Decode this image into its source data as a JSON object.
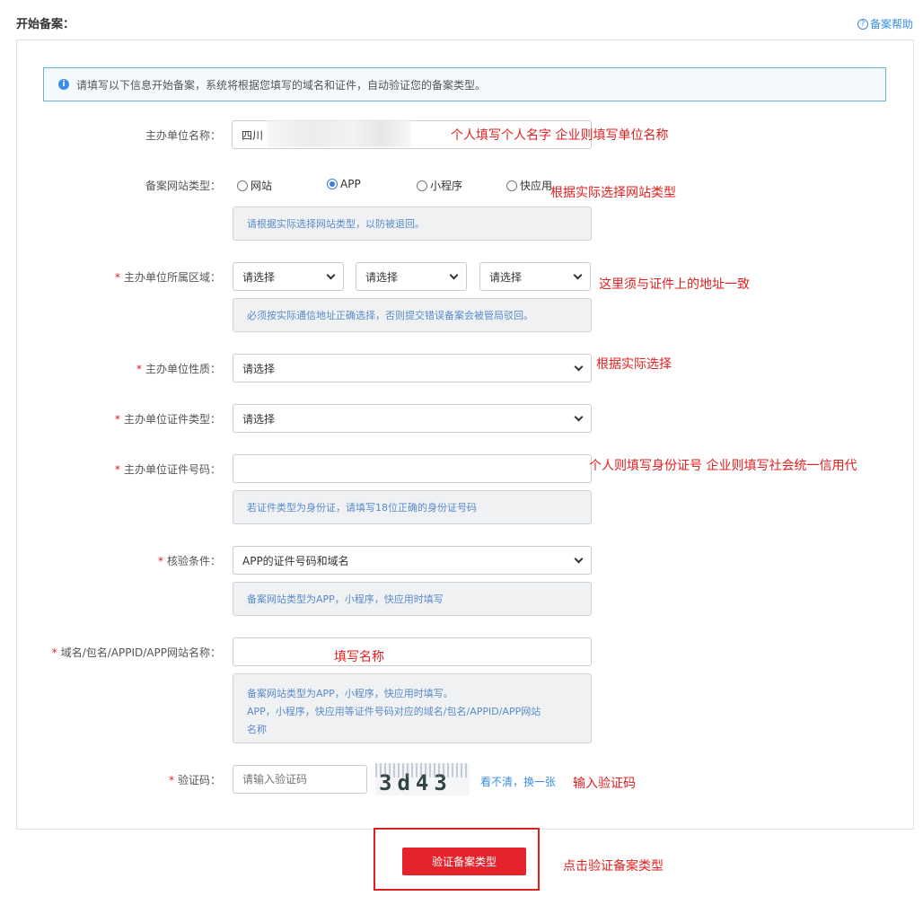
{
  "header": {
    "title": "开始备案：",
    "help_label": "备案帮助",
    "help_icon": "question-circle-icon"
  },
  "notice": {
    "icon": "info-icon",
    "text": "请填写以下信息开始备案，系统将根据您填写的域名和证件，自动验证您的备案类型。"
  },
  "form": {
    "org_name": {
      "label": "主办单位名称：",
      "value": "四川",
      "annotation": "个人填写个人名字   企业则填写单位名称"
    },
    "site_type": {
      "label": "备案网站类型：",
      "options": [
        "网站",
        "APP",
        "小程序",
        "快应用"
      ],
      "selected": "APP",
      "annotation": "根据实际选择网站类型",
      "hint": "请根据实际选择网站类型，以防被退回。"
    },
    "region": {
      "label": "主办单位所属区域：",
      "selects": [
        "请选择",
        "请选择",
        "请选择"
      ],
      "annotation": "这里须与证件上的地址一致",
      "hint": "必须按实际通信地址正确选择，否则提交错误备案会被管局驳回。"
    },
    "org_nature": {
      "label": "主办单位性质：",
      "value": "请选择",
      "annotation": "根据实际选择"
    },
    "cert_type": {
      "label": "主办单位证件类型：",
      "value": "请选择"
    },
    "cert_number": {
      "label": "主办单位证件号码：",
      "value": "",
      "annotation": "个人则填写身份证号   企业则填写社会统一信用代",
      "hint": "若证件类型为身份证，请填写18位正确的身份证号码"
    },
    "verify_condition": {
      "label": "核验条件：",
      "value": "APP的证件号码和域名",
      "hint": "备案网站类型为APP，小程序，快应用时填写"
    },
    "domain": {
      "label": "域名/包名/APPID/APP网站名称：",
      "value": "",
      "annotation": "填写名称",
      "hint_lines": [
        "备案网站类型为APP，小程序，快应用时填写。",
        "APP，小程序，快应用等证件号码对应的域名/包名/APPID/APP网站",
        "名称"
      ]
    },
    "captcha": {
      "label": "验证码：",
      "placeholder": "请输入验证码",
      "image_text": "3d43",
      "refresh_label": "看不清，换一张",
      "annotation": "输入验证码"
    }
  },
  "submit": {
    "label": "验证备案类型",
    "annotation": "点击验证备案类型"
  }
}
